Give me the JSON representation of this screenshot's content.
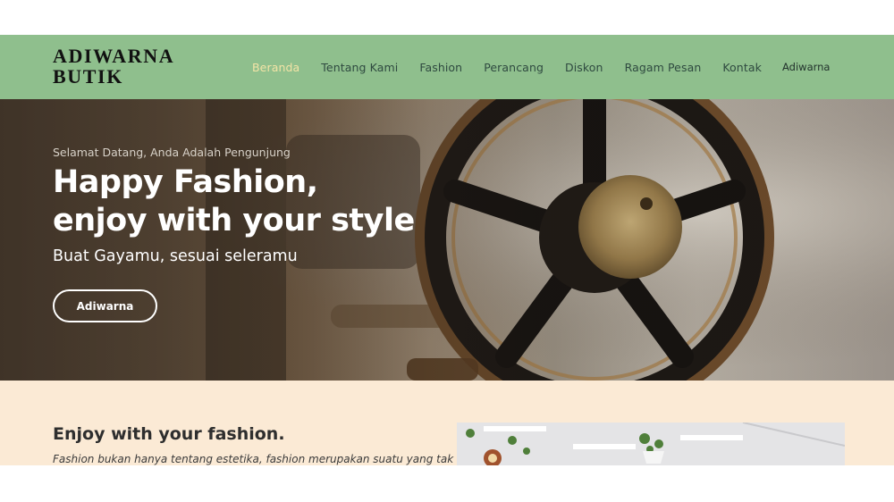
{
  "brand": {
    "logo_line1": "ADIWARNA",
    "logo_line2": "BUTIK"
  },
  "nav": {
    "items": [
      {
        "label": "Beranda",
        "active": true
      },
      {
        "label": "Tentang Kami"
      },
      {
        "label": "Fashion"
      },
      {
        "label": "Perancang"
      },
      {
        "label": "Diskon"
      },
      {
        "label": "Ragam Pesan"
      },
      {
        "label": "Kontak"
      }
    ],
    "brand_link": "Adiwarna"
  },
  "hero": {
    "welcome": "Selamat Datang, Anda Adalah Pengunjung",
    "title_line1": "Happy Fashion,",
    "title_line2": "enjoy with your style",
    "subtitle": "Buat Gayamu, sesuai seleramu",
    "button_label": "Adiwarna",
    "image_icon": "sewing-machine-wheel-photo"
  },
  "about": {
    "heading": "Enjoy with your fashion.",
    "text": "Fashion bukan hanya tentang estetika, fashion merupakan suatu yang tak",
    "image_icon": "boutique-interior-photo"
  },
  "colors": {
    "navbar": "#8fbf8d",
    "nav_active": "#f3e4a6",
    "about_bg": "#fbead5"
  }
}
